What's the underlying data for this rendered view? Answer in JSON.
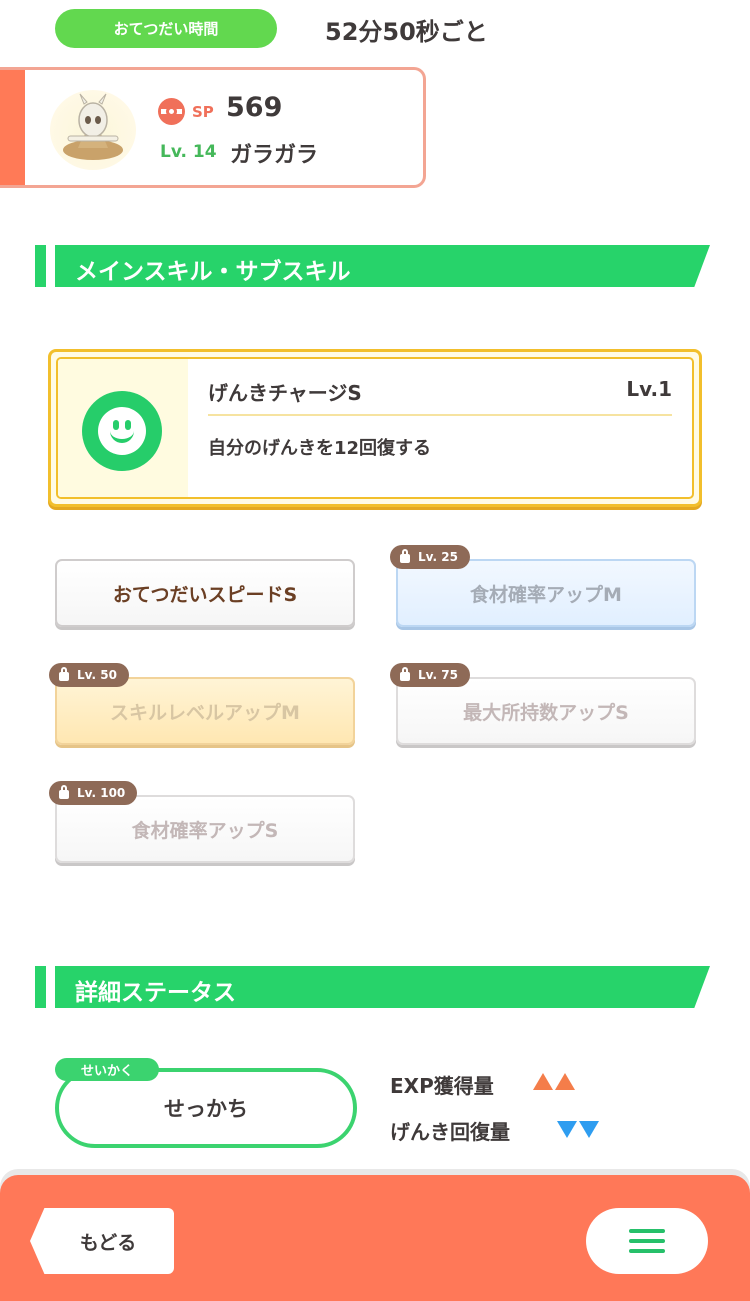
{
  "header": {
    "help_label": "おてつだい時間",
    "help_time": "52分50秒ごと"
  },
  "pokemon": {
    "sp_label": "SP",
    "sp_value": "569",
    "level": "Lv. 14",
    "name": "ガラガラ"
  },
  "sections": {
    "skills_title": "メインスキル・サブスキル",
    "status_title": "詳細ステータス"
  },
  "main_skill": {
    "name": "げんきチャージS",
    "level": "Lv.1",
    "description": "自分のげんきを12回復する",
    "icon": "smile-icon"
  },
  "sub_skills": [
    {
      "label": "おてつだいスピードS",
      "lock_level": "",
      "state": "active"
    },
    {
      "label": "食材確率アップM",
      "lock_level": "Lv. 25",
      "state": "locked"
    },
    {
      "label": "スキルレベルアップM",
      "lock_level": "Lv. 50",
      "state": "locked"
    },
    {
      "label": "最大所持数アップS",
      "lock_level": "Lv. 75",
      "state": "locked"
    },
    {
      "label": "食材確率アップS",
      "lock_level": "Lv. 100",
      "state": "locked"
    }
  ],
  "nature": {
    "tag": "せいかく",
    "value": "せっかち",
    "effects": [
      {
        "label": "EXP獲得量",
        "direction": "up",
        "color": "#f47d4a"
      },
      {
        "label": "げんき回復量",
        "direction": "down",
        "color": "#2e9df0"
      }
    ]
  },
  "footer": {
    "back_label": "もどる",
    "menu_icon": "hamburger-menu-icon"
  },
  "colors": {
    "accent_green": "#27d36a",
    "footer_orange": "#ff7858",
    "skill_gold": "#f2bf2c"
  }
}
